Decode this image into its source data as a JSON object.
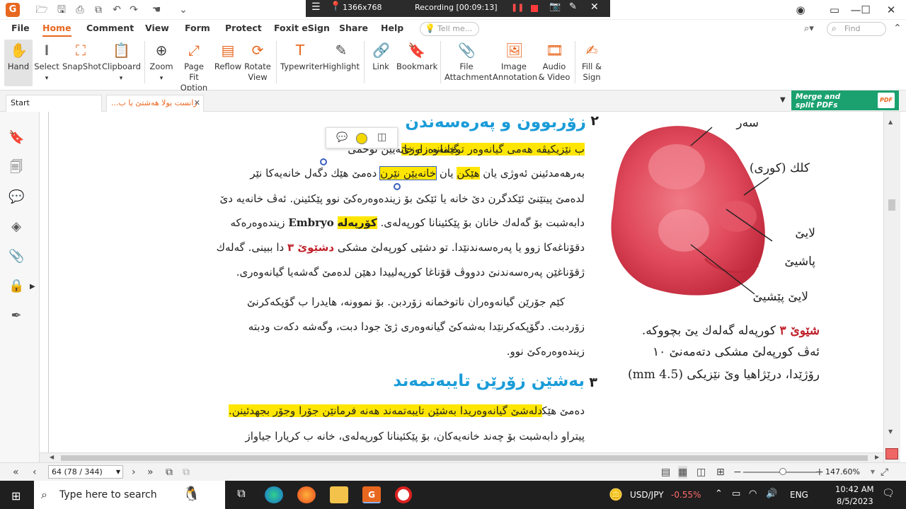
{
  "titlebar": {
    "resolution": "1366x768",
    "recording": "Recording [00:09:13]"
  },
  "menu_tabs": [
    "File",
    "Home",
    "Comment",
    "View",
    "Form",
    "Protect",
    "Foxit eSign",
    "Share",
    "Help"
  ],
  "tell_me_placeholder": "Tell me...",
  "find_placeholder": "Find",
  "ribbon": {
    "hand": "Hand",
    "select": "Select",
    "snapshot": "SnapShot",
    "clipboard": "Clipboard",
    "zoom": "Zoom",
    "page_fit_1": "Page Fit",
    "page_fit_2": "Option",
    "reflow": "Reflow",
    "rotate_1": "Rotate",
    "rotate_2": "View",
    "typewriter": "Typewriter",
    "highlight": "Highlight",
    "link": "Link",
    "bookmark": "Bookmark",
    "file_att_1": "File",
    "file_att_2": "Attachment",
    "image_ann_1": "Image",
    "image_ann_2": "Annotation",
    "audio_1": "Audio",
    "audio_2": "& Video",
    "fill_1": "Fill &",
    "fill_2": "Sign"
  },
  "doc_tabs": {
    "start": "Start",
    "doc": "...زانست يولا هەشتێ يا ب"
  },
  "merge_banner": {
    "line1": "Merge and",
    "line2": "split PDFs"
  },
  "page": {
    "heading2_num": "٢",
    "heading2": "زۆربوون و پەرەسەندن",
    "line1_plain": "ب نێزيكيڤە هەمى گيانەوەر توخمانە زاوزێ",
    "line1_tail": "گيانەوەرە خانەيێن توخمى",
    "line2_a": "بەرهەمدئينن ئەوژى يان",
    "line2_hl1": "هێكن",
    "line2_b": "يان",
    "line2_hl2": "خانەيێن نێرن",
    "line2_c": "دەمێ هێك دگەل خانەيەكا نێر",
    "line3": "لدەمێ پيتێنێ ئێكدگرن دێ خانە يا ئێكێ بۆ زيندەوەرەكێ نوو پێكئينن. ئەڤ خانەيە دێ",
    "line4_a": "دابەشبت بۆ گەلەك خانان بۆ پێكئينانا كورپەلەى.",
    "line4_hl": "كۆرپەلە",
    "line4_en": "Embryo",
    "line4_b": "زيندەوەرەكە",
    "line5_a": "دقۆناغەكا زوو يا پەرەسەندنێدا. تو دشێى كورپەلێ مشكى",
    "line5_red": "دشێوێ ٣",
    "line5_b": "دا ببينى. گەلەك",
    "line6": "ژقۆناغێن پەرەسەندنێ ددووڤ قۆناغا كورپەلييدا دهێن لدەمێ گەشەيا گيانەوەرى.",
    "line7": "كێم جۆرێن گيانەوەران ناتوخمانە زۆردبن. بۆ نموونە، هايدرا ب گۆپكەكرنێ",
    "line8": "زۆردبت. دگۆپكەكرنێدا بەشەكێ گيانەوەرى ژێ جودا دبت، وگەشە دكەت ودبتە",
    "line9": "زيندەوەرەكێ نوو.",
    "heading3_num": "٣",
    "heading3": "بەشێن زۆرێن تايبەتمەند",
    "line10_hl": "دلەشێ گيانەوەريدا بەشێن تايبەتمەند هەنە فرمانێن جۆرا وجۆر بجهدئينن.",
    "line10_b": "دەمێ هێكا",
    "line11": "پيتراو دابەشبت بۆ چەند خانەيەكان، بۆ پێكئينانا كورپەلەى، خانە ب كريارا جياواز"
  },
  "figure": {
    "label_head": "سەر",
    "label_tail": "كلك (كورى)",
    "label_hind_1": "لايێ",
    "label_hind_2": "پاشيێ",
    "label_fore": "لايێ پێشيێ",
    "caption_red": "شێوێ ٣",
    "caption_1": "كورپەلە گەلەك يێ بچووكە.",
    "caption_2": "ئەڤ كورپەلێ مشكى دتەمەنێ ١٠",
    "caption_3": "رۆژێدا، درێژاهيا وێ نێزيكى (4.5 mm)"
  },
  "statusbar": {
    "page_indicator": "64 (78 / 344)",
    "zoom": "147.60%"
  },
  "taskbar": {
    "search_placeholder": "Type here to search",
    "currency": "USD/JPY",
    "currency_change": "-0.55%",
    "lang": "ENG",
    "time": "10:42 AM",
    "date": "8/5/2023"
  },
  "colors": {
    "accent": "#e8671f",
    "highlight": "#ffe600",
    "heading": "#1a9cd8",
    "figure_red": "#c0202a",
    "merge_green": "#1aa16f"
  }
}
